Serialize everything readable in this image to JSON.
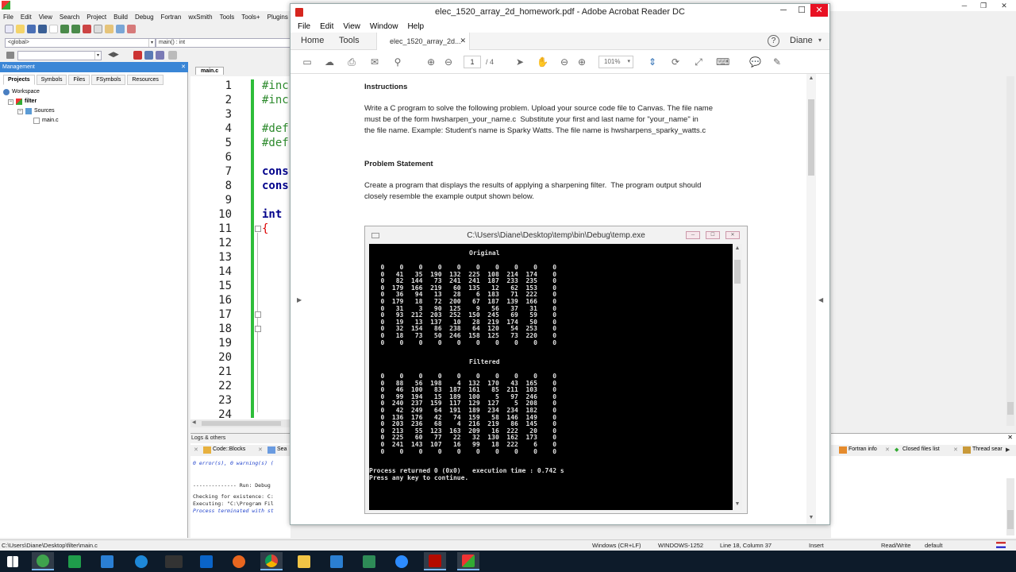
{
  "codeblocks": {
    "menu": [
      "File",
      "Edit",
      "View",
      "Search",
      "Project",
      "Build",
      "Debug",
      "Fortran",
      "wxSmith",
      "Tools",
      "Tools+",
      "Plugins"
    ],
    "scope_combo": "<global>",
    "function_combo": "main() : int",
    "management_title": "Management",
    "management_tabs": [
      "Projects",
      "Symbols",
      "Files",
      "FSymbols",
      "Resources"
    ],
    "tree": {
      "workspace": "Workspace",
      "project": "filter",
      "folder": "Sources",
      "file": "main.c"
    },
    "editor_tab": "main.c",
    "line_numbers": [
      "1",
      "2",
      "3",
      "4",
      "5",
      "6",
      "7",
      "8",
      "9",
      "10",
      "11",
      "12",
      "13",
      "14",
      "15",
      "16",
      "17",
      "18",
      "19",
      "20",
      "21",
      "22",
      "23",
      "24"
    ],
    "code": {
      "l1": "#inc",
      "l2": "#inc",
      "l4": "#def",
      "l5": "#def",
      "l7": "cons",
      "l8": "cons",
      "l10": "int",
      "l11": "{"
    },
    "logs_title": "Logs & others",
    "logs_tabs": [
      "Code::Blocks",
      "Sea"
    ],
    "logs_lines": [
      "0 error(s), 0 warning(s) (",
      "-------------- Run: Debug",
      "Checking for existence: C:",
      "Executing: \"C:\\Program Fil",
      "Process terminated with st"
    ],
    "right_tabs": [
      "Fortran info",
      "Closed files list",
      "Thread sear"
    ],
    "status": {
      "path": "C:\\Users\\Diane\\Desktop\\filter\\main.c",
      "eol": "Windows (CR+LF)",
      "encoding": "WINDOWS-1252",
      "position": "Line 18, Column 37",
      "mode": "Insert",
      "rw": "Read/Write",
      "profile": "default"
    }
  },
  "acrobat": {
    "title": "elec_1520_array_2d_homework.pdf - Adobe Acrobat Reader DC",
    "menu": [
      "File",
      "Edit",
      "View",
      "Window",
      "Help"
    ],
    "tab_home": "Home",
    "tab_tools": "Tools",
    "doc_tab": "elec_1520_array_2d...",
    "user": "Diane",
    "page_current": "1",
    "page_total": "/ 4",
    "zoom": "101%",
    "instructions_heading": "Instructions",
    "instructions_text": "Write a C program to solve the following problem. Upload your source code file to Canvas. The file name\nmust be of the form hwsharpen_your_name.c  Substitute your first and last name for \"your_name\" in\nthe file name. Example: Student’s name is Sparky Watts. The file name is hwsharpens_sparky_watts.c",
    "problem_heading": "Problem Statement",
    "problem_text": "Create a program that displays the results of applying a sharpening filter.  The program output should\nclosely resemble the example output shown below.",
    "console": {
      "title": "C:\\Users\\Diane\\Desktop\\temp\\bin\\Debug\\temp.exe",
      "original_label": "Original",
      "original_rows": [
        "   0    0    0    0    0    0    0    0    0    0",
        "   0   41   35  190  132  225  108  214  174    0",
        "   0   82  144   73  241  241  187  233  235    0",
        "   0  179  166  219   60  135   12   62  153    0",
        "   0   36   94   13   28    6  183   71  222    0",
        "   0  179   18   72  200   67  187  139  166    0",
        "   0   31    3   90  125    9   56   37   31    0",
        "   0   93  212  203  252  150  245   69   59    0",
        "   0   19   13  137   10   28  219  174   50    0",
        "   0   32  154   86  238   64  120   54  253    0",
        "   0   18   73   50  246  158  125   73  220    0",
        "   0    0    0    0    0    0    0    0    0    0"
      ],
      "filtered_label": "Filtered",
      "filtered_rows": [
        "   0    0    0    0    0    0    0    0    0    0",
        "   0   88   56  198    4  132  170   43  165    0",
        "   0   46  100   83  187  161   85  211  103    0",
        "   0   99  194   15  189  100    5   97  246    0",
        "   0  240  237  159  117  129  127    5  208    0",
        "   0   42  249   64  191  189  234  234  182    0",
        "   0  136  176   42   74  159   58  146  149    0",
        "   0  203  236   68    4  216  219   86  145    0",
        "   0  213   55  123  163  209   16  222   20    0",
        "   0  225   60   77   22   32  130  162  173    0",
        "   0  241  143  107   16   99   18  222    6    0",
        "   0    0    0    0    0    0    0    0    0    0"
      ],
      "process_line": "Process returned 0 (0x0)   execution time : 0.742 s",
      "continue_line": "Press any key to continue."
    }
  }
}
